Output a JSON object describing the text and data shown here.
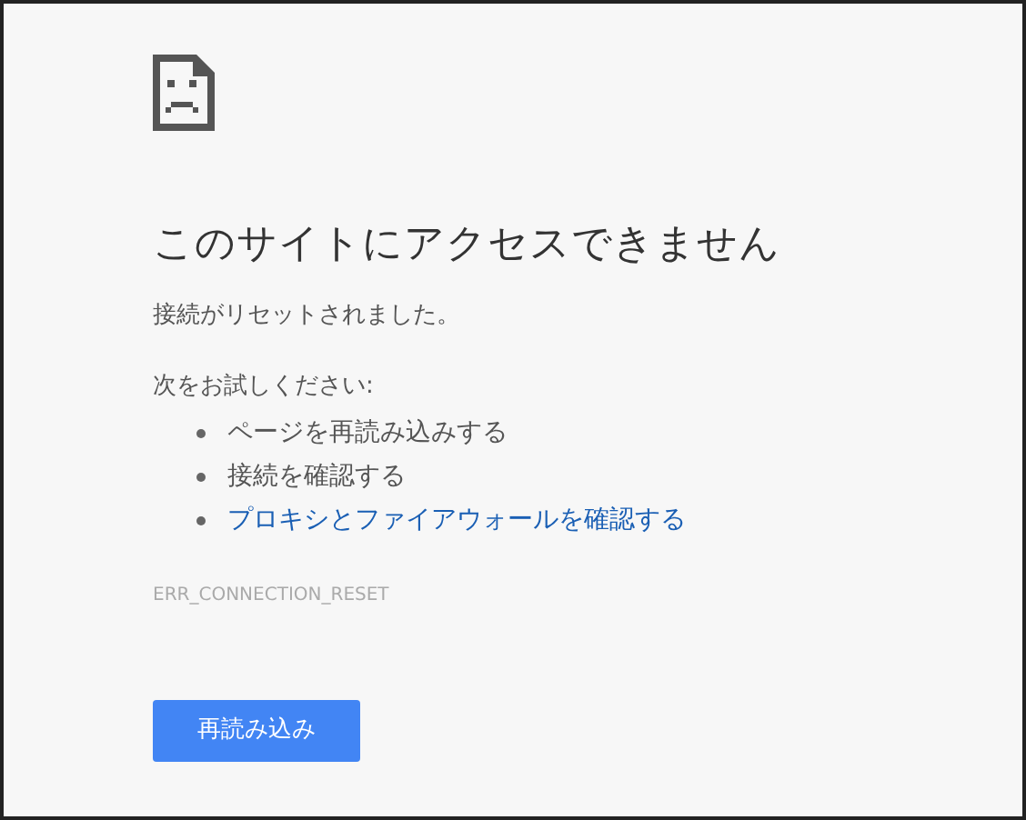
{
  "title": "このサイトにアクセスできません",
  "message": "接続がリセットされました。",
  "suggestions": {
    "heading": "次をお試しください:",
    "items": [
      {
        "kind": "text",
        "label": "ページを再読み込みする"
      },
      {
        "kind": "text",
        "label": "接続を確認する"
      },
      {
        "kind": "link",
        "label": "プロキシとファイアウォールを確認する"
      }
    ]
  },
  "error_code": "ERR_CONNECTION_RESET",
  "reload_button": "再読み込み"
}
